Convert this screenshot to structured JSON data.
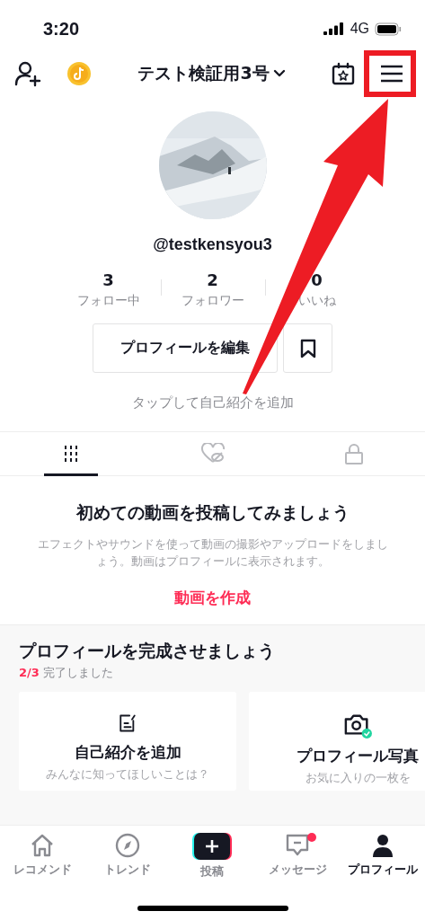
{
  "status_bar": {
    "time": "3:20",
    "network": "4G"
  },
  "header": {
    "title": "テスト検証用3号"
  },
  "profile": {
    "username": "@testkensyou3",
    "stats": [
      {
        "value": "3",
        "label": "フォロー中"
      },
      {
        "value": "2",
        "label": "フォロワー"
      },
      {
        "value": "0",
        "label": "いいね"
      }
    ],
    "edit_button": "プロフィールを編集",
    "bio_hint": "タップして自己紹介を追加"
  },
  "tabs": [
    {
      "kind": "grid",
      "selected": true
    },
    {
      "kind": "liked",
      "selected": false
    },
    {
      "kind": "private",
      "selected": false
    }
  ],
  "empty_state": {
    "title": "初めての動画を投稿してみましょう",
    "description": "エフェクトやサウンドを使って動画の撮影やアップロードをしましょう。動画はプロフィールに表示されます。",
    "link": "動画を作成"
  },
  "completion": {
    "title": "プロフィールを完成させましょう",
    "progress": "2/3",
    "progress_text": "完了しました",
    "cards": [
      {
        "kind": "bio",
        "title": "自己紹介を追加",
        "subtitle": "みんなに知ってほしいことは？",
        "done": false
      },
      {
        "title": "プロフィール写真",
        "subtitle": "お気に入りの一枚を",
        "done": true
      }
    ]
  },
  "nav": [
    {
      "kind": "home",
      "label": "レコメンド",
      "selected": false,
      "badge": false
    },
    {
      "kind": "compass",
      "label": "トレンド",
      "selected": false,
      "badge": false
    },
    {
      "kind": "post",
      "label": "投稿",
      "selected": false,
      "badge": false
    },
    {
      "kind": "inbox",
      "label": "メッセージ",
      "selected": false,
      "badge": true
    },
    {
      "kind": "profile",
      "label": "プロフィール",
      "selected": true,
      "badge": false
    }
  ],
  "annotation": {
    "kind": "arrow-to-menu"
  }
}
